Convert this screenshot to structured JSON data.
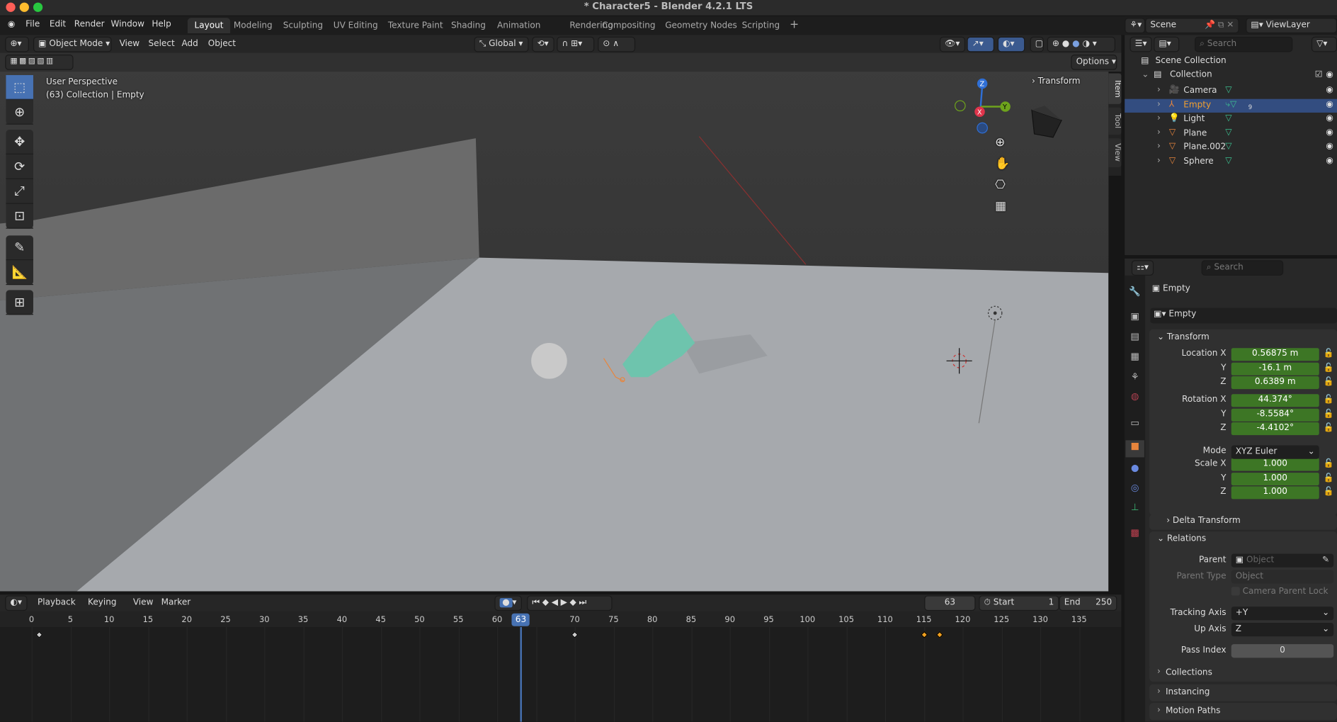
{
  "window": {
    "title": "* Character5 - Blender 4.2.1 LTS"
  },
  "menu": {
    "items": [
      "File",
      "Edit",
      "Render",
      "Window",
      "Help"
    ]
  },
  "workspaces": {
    "tabs": [
      "Layout",
      "Modeling",
      "Sculpting",
      "UV Editing",
      "Texture Paint",
      "Shading",
      "Animation",
      "Rendering",
      "Compositing",
      "Geometry Nodes",
      "Scripting"
    ],
    "active": "Layout",
    "add": "+"
  },
  "viewport": {
    "mode": "Object Mode",
    "menus": [
      "View",
      "Select",
      "Add",
      "Object"
    ],
    "orientation": "Global",
    "options": "Options",
    "overlay_title": "User Perspective",
    "overlay_subtitle": "(63) Collection | Empty",
    "npanel_header": "Transform",
    "ntabs": [
      "Item",
      "Tool",
      "View"
    ],
    "gizmo": {
      "z": "Z",
      "y": "Y",
      "x": "X",
      "z_color": "#2f6fd6",
      "y_color": "#6ea31c",
      "x_color": "#e0344b"
    },
    "tools": [
      "select-box",
      "cursor",
      "move",
      "rotate",
      "scale",
      "transform",
      "annotate",
      "measure",
      "add-cube"
    ]
  },
  "scene_bar": {
    "scene": "Scene",
    "view_layer": "ViewLayer"
  },
  "outliner": {
    "search_placeholder": "Search",
    "root": "Scene Collection",
    "collection": "Collection",
    "items": [
      {
        "name": "Camera",
        "icon": "camera-icon",
        "selected": false
      },
      {
        "name": "Empty",
        "icon": "empty-icon",
        "selected": true,
        "badge": "9"
      },
      {
        "name": "Light",
        "icon": "light-icon",
        "selected": false
      },
      {
        "name": "Plane",
        "icon": "mesh-icon",
        "selected": false
      },
      {
        "name": "Plane.002",
        "icon": "mesh-icon",
        "selected": false
      },
      {
        "name": "Sphere",
        "icon": "mesh-icon",
        "selected": false
      }
    ]
  },
  "properties": {
    "search_placeholder": "Search",
    "object_title": "Empty",
    "object_name": "Empty",
    "transform": {
      "title": "Transform",
      "location_label": "Location X",
      "location": [
        "0.56875 m",
        "-16.1 m",
        "0.6389 m"
      ],
      "rotation_label": "Rotation X",
      "rotation": [
        "44.374°",
        "-8.5584°",
        "-4.4102°"
      ],
      "mode_label": "Mode",
      "mode": "XYZ Euler",
      "scale_label": "Scale X",
      "scale": [
        "1.000",
        "1.000",
        "1.000"
      ],
      "y": "Y",
      "z": "Z"
    },
    "delta_transform": "Delta Transform",
    "relations": {
      "title": "Relations",
      "parent_label": "Parent",
      "parent_placeholder": "Object",
      "parent_type_label": "Parent Type",
      "parent_type": "Object",
      "camera_parent_lock": "Camera Parent Lock",
      "tracking_axis_label": "Tracking Axis",
      "tracking_axis": "+Y",
      "up_axis_label": "Up Axis",
      "up_axis": "Z",
      "pass_index_label": "Pass Index",
      "pass_index": "0"
    },
    "collapsed": [
      "Collections",
      "Instancing",
      "Motion Paths"
    ],
    "field_color": "#3d7625"
  },
  "timeline": {
    "menus": [
      "Playback",
      "Keying",
      "View",
      "Marker"
    ],
    "current_frame": "63",
    "start_label": "Start",
    "start": "1",
    "end_label": "End",
    "end": "250",
    "ruler_labels": [
      "0",
      "5",
      "10",
      "15",
      "20",
      "25",
      "30",
      "35",
      "40",
      "45",
      "50",
      "55",
      "60",
      "65",
      "70",
      "75",
      "80",
      "85",
      "90",
      "95",
      "100",
      "105",
      "110",
      "115",
      "120",
      "125",
      "130",
      "135"
    ],
    "keyframes": [
      {
        "frame": 1,
        "selected": false
      },
      {
        "frame": 70,
        "selected": false
      },
      {
        "frame": 115,
        "selected": true
      },
      {
        "frame": 117,
        "selected": true
      }
    ],
    "accent": "#4772b3",
    "selected_key_color": "#f0a020"
  }
}
